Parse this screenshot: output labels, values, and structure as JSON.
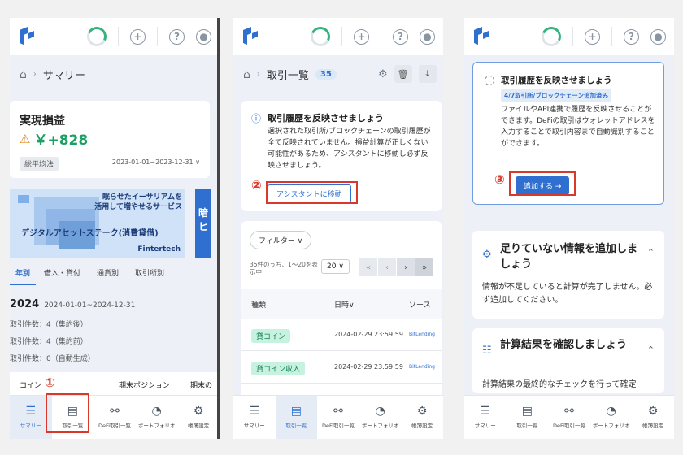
{
  "screen1": {
    "breadcrumb": "サマリー",
    "profit_card": {
      "title": "実現損益",
      "value": "￥+828",
      "method": "総平均法",
      "date_range": "2023-01-01~2023-12-31 ∨"
    },
    "banner": {
      "line1": "眠らせたイーサリアムを",
      "line2": "活用して増やせるサービス",
      "line3": "デジタルアセットステーク(消費貸借)",
      "brand": "Fintertech",
      "right": "暗",
      "right2": "ヒ"
    },
    "tabs": [
      "年別",
      "借入・貸付",
      "通貨別",
      "取引所別"
    ],
    "year": "2024",
    "year_range": "2024-01-01~2024-12-31",
    "stats": [
      "取引件数：4（集約後）",
      "取引件数：4（集約前）",
      "取引件数：0（自動生成）"
    ],
    "table_head": [
      "コイン",
      "期末ポジション",
      "期末の"
    ],
    "step": "①"
  },
  "screen2": {
    "breadcrumb": "取引一覧",
    "count": "35",
    "notice": {
      "title": "取引履歴を反映させましょう",
      "body": "選択された取引所/ブロックチェーンの取引履歴が全て反映されていません。損益計算が正しくない可能性があるため、アシスタントに移動し必ず反映させましょう。",
      "button": "アシスタントに移動"
    },
    "step": "②",
    "filter": "フィルター ∨",
    "showing": "35件のうち、1〜20を表示中",
    "per_page": "20 ∨",
    "columns": [
      "種類",
      "日時∨",
      "ソース"
    ],
    "rows": [
      {
        "type": "貸コイン",
        "date": "2024-02-29 23:59:59",
        "source": "BitLending"
      },
      {
        "type": "貸コイン収入",
        "date": "2024-02-29 23:59:59",
        "source": "BitLending"
      }
    ]
  },
  "screen3": {
    "task": {
      "title": "取引履歴を反映させましょう",
      "badge": "4/7取引所/ブロックチェーン追加済み",
      "body": "ファイルやAPI連携で履歴を反映させることができます。DeFiの取引はウォレットアドレスを入力することで取引内容まで自動識別することができます。",
      "button": "追加する →"
    },
    "step": "③",
    "section1": {
      "title": "足りていない情報を追加しましょう",
      "body": "情報が不足していると計算が完了しません。必ず追加してください。"
    },
    "section2": {
      "title": "計算結果を確認しましょう",
      "body": "計算結果の最終的なチェックを行って確定"
    }
  },
  "tabbar": [
    "サマリー",
    "取引一覧",
    "DeFi取引一覧",
    "ポートフォリオ",
    "帳簿設定"
  ],
  "colors": {
    "accent": "#2f6fd0",
    "green": "#1e9e63",
    "red_marker": "#d8392b"
  }
}
